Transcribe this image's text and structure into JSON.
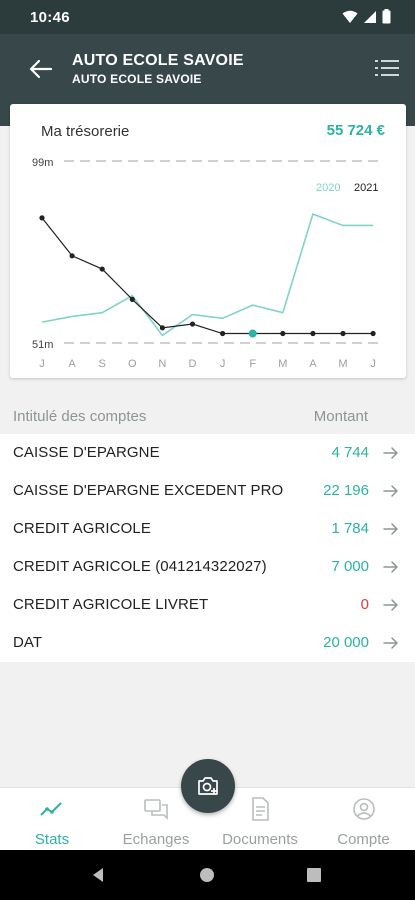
{
  "status": {
    "time": "10:46"
  },
  "header": {
    "title": "AUTO ECOLE SAVOIE",
    "subtitle": "AUTO ECOLE SAVOIE"
  },
  "treasury": {
    "title": "Ma trésorerie",
    "amount": "55 724 €"
  },
  "chart_data": {
    "type": "line",
    "x": [
      "J",
      "A",
      "S",
      "O",
      "N",
      "D",
      "J",
      "F",
      "M",
      "A",
      "M",
      "J"
    ],
    "ylim": [
      51,
      99
    ],
    "y_tick_labels": {
      "max": "99m",
      "min": "51m"
    },
    "grid": true,
    "legend_placement": "top-right",
    "series": [
      {
        "name": "2020",
        "color": "#7fd4c9",
        "values": [
          56.5,
          58,
          59,
          63.5,
          53,
          58.5,
          57.5,
          61,
          59,
          85,
          82,
          82
        ]
      },
      {
        "name": "2021",
        "color": "#222222",
        "values": [
          84,
          74,
          70.5,
          62.5,
          55,
          56,
          53.5,
          53.5,
          53.5,
          53.5,
          53.5,
          53.5
        ],
        "highlight_index": 7
      }
    ]
  },
  "accounts": {
    "header_label": "Intitulé des comptes",
    "header_amount": "Montant",
    "rows": [
      {
        "name": "CAISSE D'EPARGNE",
        "value": "4 744"
      },
      {
        "name": "CAISSE D'EPARGNE EXCEDENT PRO",
        "value": "22 196"
      },
      {
        "name": "CREDIT AGRICOLE",
        "value": "1 784"
      },
      {
        "name": "CREDIT AGRICOLE (041214322027)",
        "value": "7 000"
      },
      {
        "name": "CREDIT AGRICOLE LIVRET",
        "value": "0",
        "negative": true
      },
      {
        "name": "DAT",
        "value": "20 000"
      }
    ]
  },
  "nav": {
    "items": [
      {
        "label": "Stats",
        "icon": "stats-icon",
        "active": true
      },
      {
        "label": "Echanges",
        "icon": "chat-icon",
        "active": false
      },
      {
        "label": "Documents",
        "icon": "document-icon",
        "active": false
      },
      {
        "label": "Compte",
        "icon": "account-icon",
        "active": false
      }
    ]
  },
  "fab": {
    "icon": "camera-add-icon"
  },
  "colors": {
    "accent": "#2bb3a3",
    "header": "#37474a",
    "negative": "#e53935",
    "series_2020": "#7fd4c9",
    "series_2021": "#222222"
  }
}
